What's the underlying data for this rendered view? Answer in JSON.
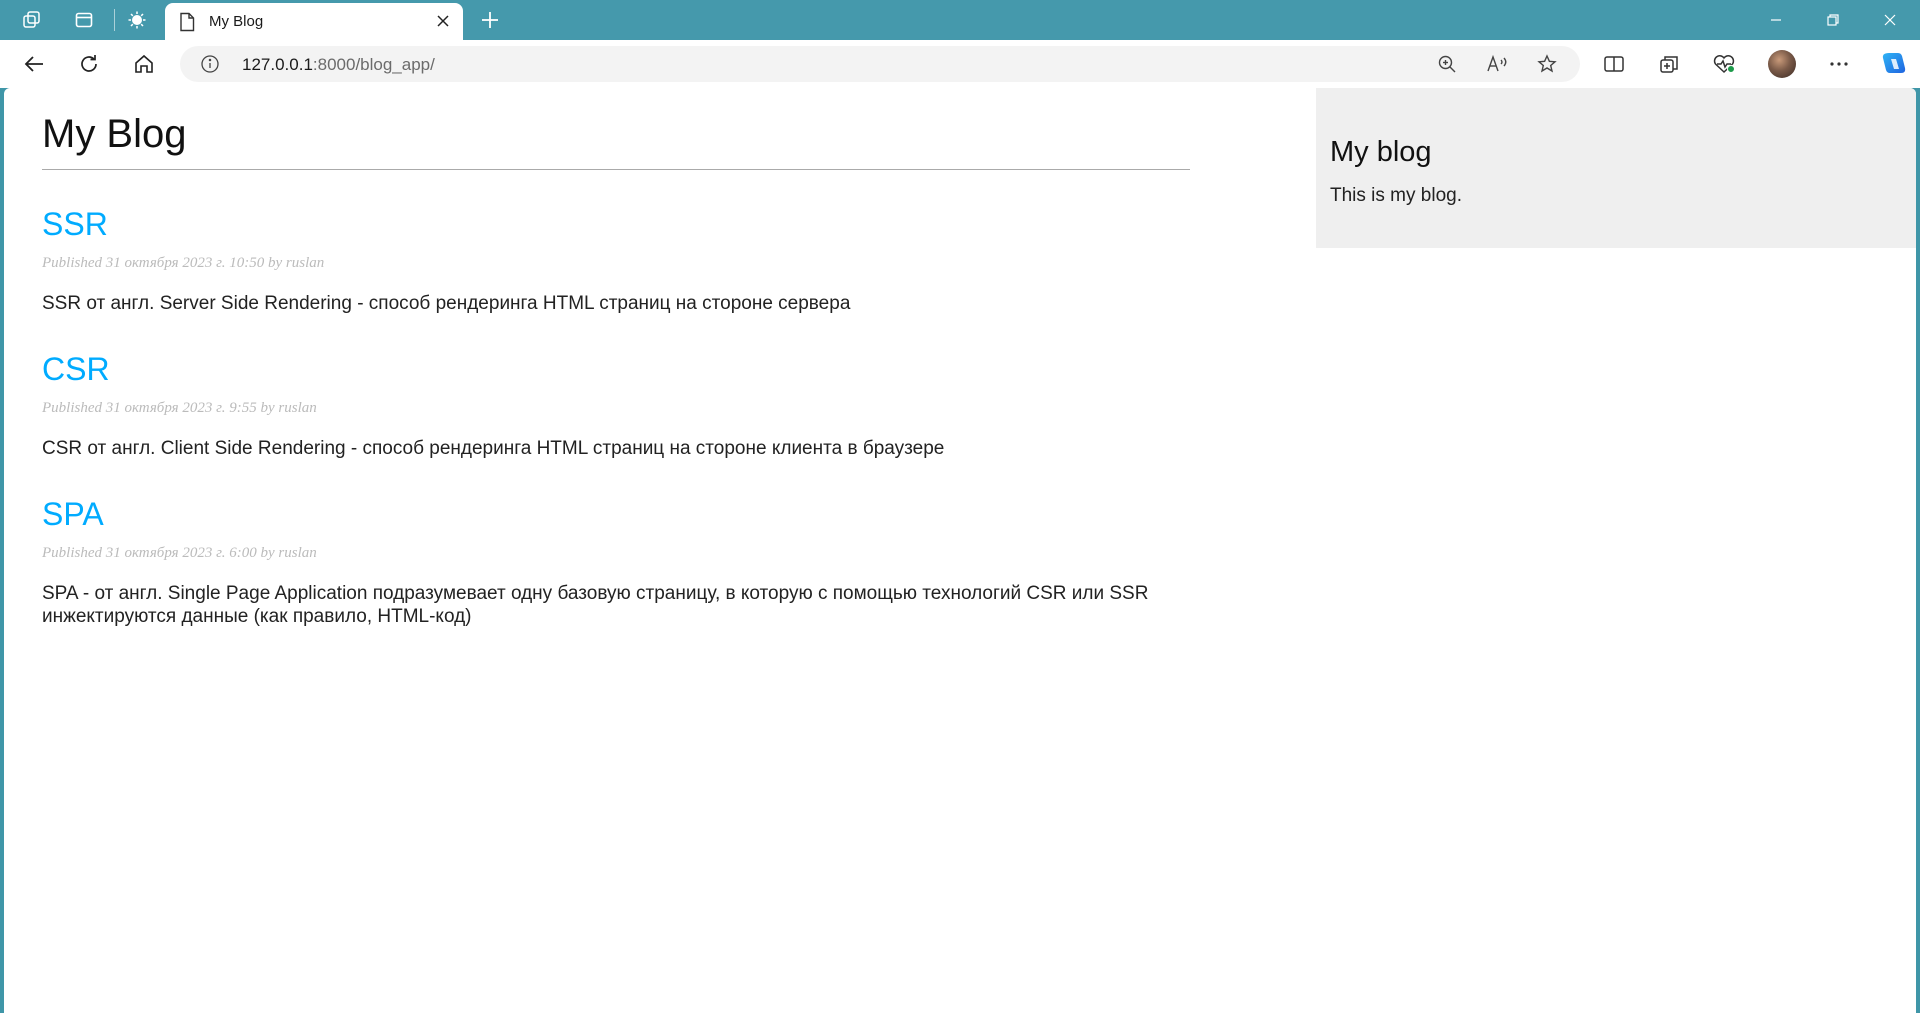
{
  "browser": {
    "tab": {
      "title": "My Blog"
    },
    "address_bar": {
      "host": "127.0.0.1",
      "path": ":8000/blog_app/"
    }
  },
  "page": {
    "heading": "My Blog",
    "posts": [
      {
        "title": "SSR",
        "meta": "Published 31 октября 2023 г. 10:50 by ruslan",
        "body": "SSR от англ. Server Side Rendering - способ рендеринга HTML страниц на стороне сервера"
      },
      {
        "title": "CSR",
        "meta": "Published 31 октября 2023 г. 9:55 by ruslan",
        "body": "CSR от англ. Client Side Rendering - способ рендеринга HTML страниц на стороне клиента в браузере"
      },
      {
        "title": "SPA",
        "meta": "Published 31 октября 2023 г. 6:00 by ruslan",
        "body": "SPA - от англ. Single Page Application подразумевает одну базовую страницу, в которую с помощью технологий CSR или SSR инжектируются данные (как правило, HTML-код)"
      }
    ],
    "sidebar": {
      "title": "My blog",
      "text": "This is my blog."
    }
  },
  "colors": {
    "titlebar": "#4599ac",
    "link": "#00abff",
    "meta": "#bbbbbb",
    "sidebar_bg": "#efefef"
  }
}
